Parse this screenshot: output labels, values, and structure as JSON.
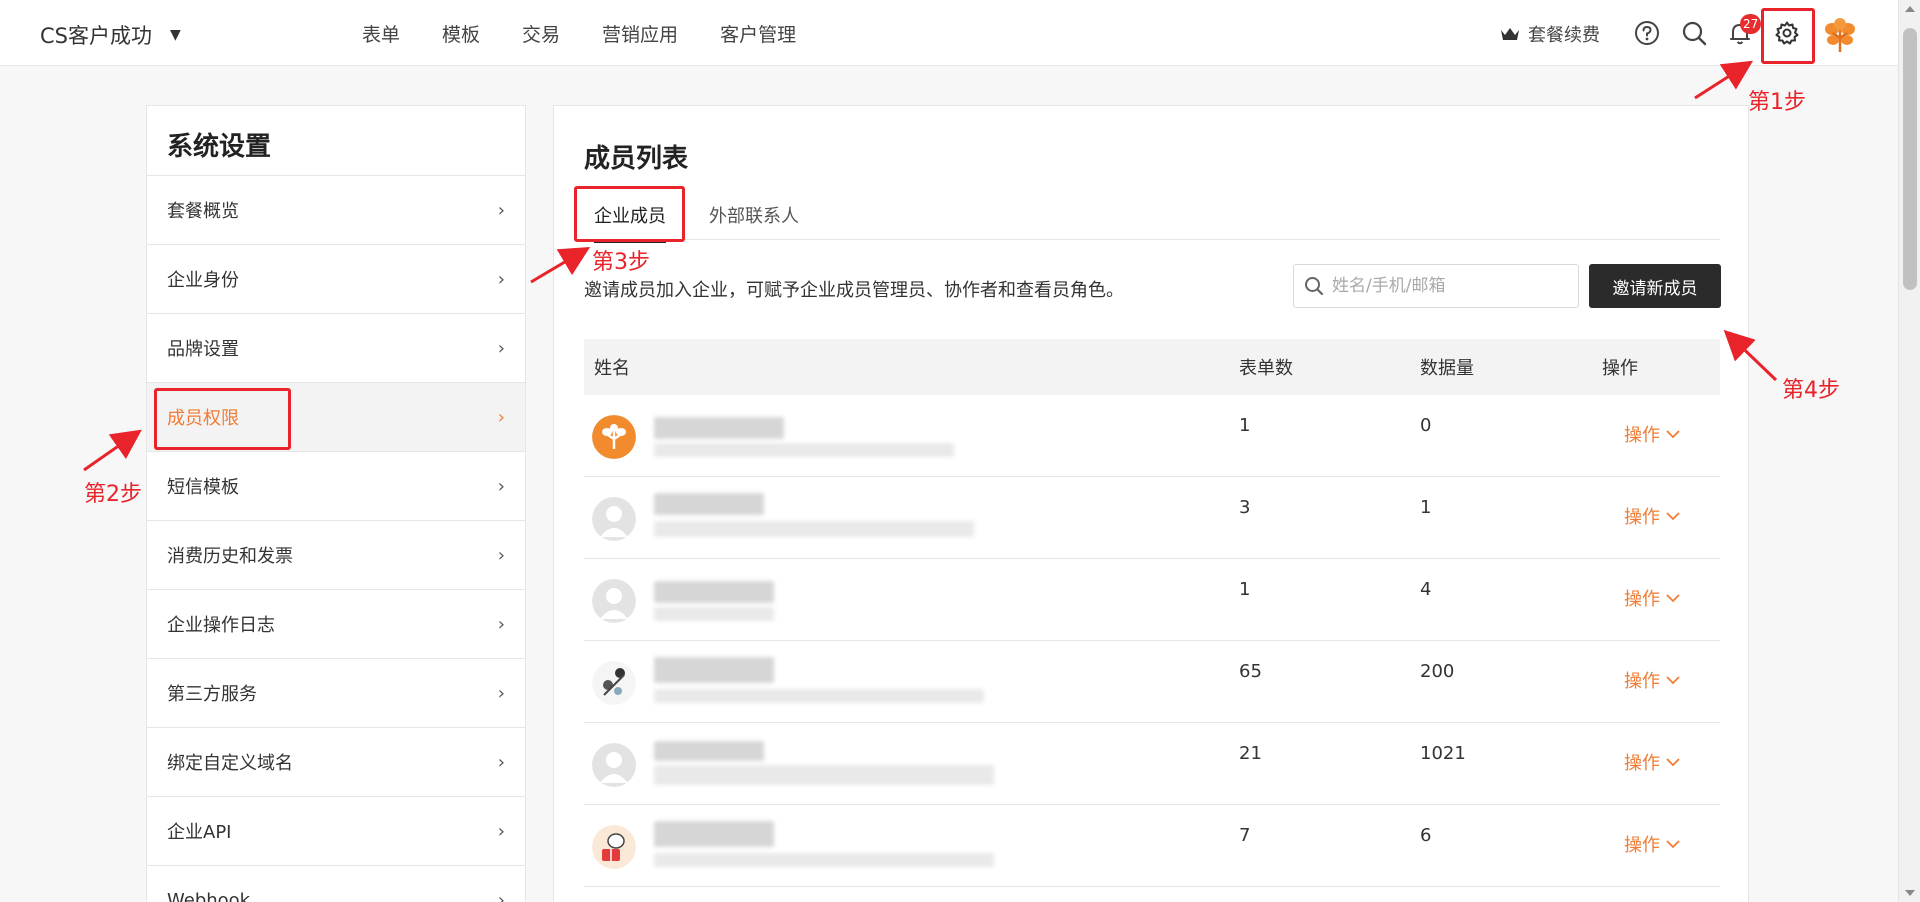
{
  "topbar": {
    "brand": "CS客户成功",
    "nav": [
      "表单",
      "模板",
      "交易",
      "营销应用",
      "客户管理"
    ],
    "renew_label": "套餐续费",
    "notification_count": "27"
  },
  "sidebar": {
    "title": "系统设置",
    "items": [
      {
        "label": "套餐概览"
      },
      {
        "label": "企业身份"
      },
      {
        "label": "品牌设置"
      },
      {
        "label": "成员权限"
      },
      {
        "label": "短信模板"
      },
      {
        "label": "消费历史和发票"
      },
      {
        "label": "企业操作日志"
      },
      {
        "label": "第三方服务"
      },
      {
        "label": "绑定自定义域名"
      },
      {
        "label": "企业API"
      },
      {
        "label": "Webhook"
      }
    ],
    "active_index": 3
  },
  "main": {
    "title": "成员列表",
    "tabs": [
      {
        "label": "企业成员"
      },
      {
        "label": "外部联系人"
      }
    ],
    "description": "邀请成员加入企业，可赋予企业成员管理员、协作者和查看员角色。",
    "search_placeholder": "姓名/手机/邮箱",
    "invite_label": "邀请新成员",
    "table": {
      "headers": [
        "姓名",
        "表单数",
        "数据量",
        "操作"
      ],
      "rows": [
        {
          "forms": "1",
          "data": "0",
          "op": "操作"
        },
        {
          "forms": "3",
          "data": "1",
          "op": "操作"
        },
        {
          "forms": "1",
          "data": "4",
          "op": "操作"
        },
        {
          "forms": "65",
          "data": "200",
          "op": "操作"
        },
        {
          "forms": "21",
          "data": "1021",
          "op": "操作"
        },
        {
          "forms": "7",
          "data": "6",
          "op": "操作"
        }
      ]
    }
  },
  "annotations": {
    "step1": "第1步",
    "step2": "第2步",
    "step3": "第3步",
    "step4": "第4步"
  },
  "colors": {
    "accent": "#f07c35",
    "annotation": "#e8232a",
    "invite_button": "#2b2b2b"
  }
}
